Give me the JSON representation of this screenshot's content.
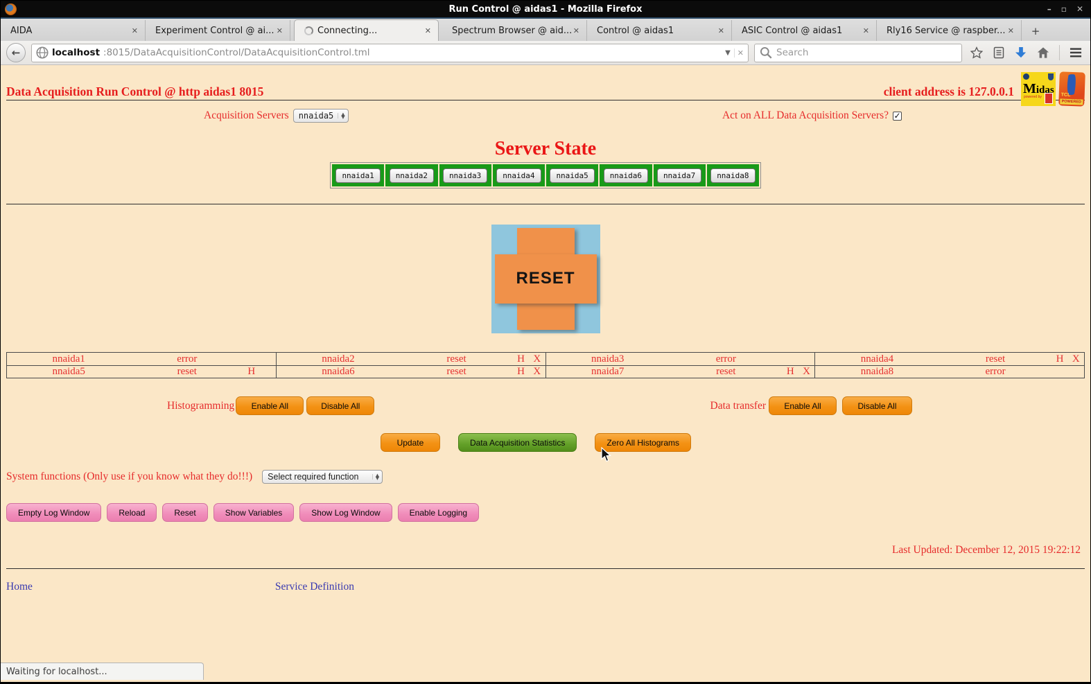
{
  "browser": {
    "window_title": "Run Control @ aidas1 - Mozilla Firefox",
    "tabs": [
      {
        "label": "AIDA"
      },
      {
        "label": "Experiment Control @ ai..."
      },
      {
        "label": "Connecting...",
        "active": true,
        "loading": true
      },
      {
        "label": "Spectrum Browser @ aid..."
      },
      {
        "label": "Control @ aidas1"
      },
      {
        "label": "ASIC Control @ aidas1"
      },
      {
        "label": "Rly16 Service @ raspber..."
      }
    ],
    "new_tab": "+",
    "url_host": "localhost",
    "url_path": ":8015/DataAcquisitionControl/DataAcquisitionControl.tml",
    "search_placeholder": "Search",
    "status_text": "Waiting for localhost..."
  },
  "page": {
    "title": "Data Acquisition Run Control @ http aidas1 8015",
    "client_address": "client address is 127.0.0.1",
    "acquisition_servers_label": "Acquisition Servers",
    "acquisition_servers_selected": "nnaida5",
    "act_on_all_label": "Act on ALL Data Acquisition Servers?",
    "act_on_all_checked": true,
    "server_state_heading": "Server State",
    "server_buttons": [
      "nnaida1",
      "nnaida2",
      "nnaida3",
      "nnaida4",
      "nnaida5",
      "nnaida6",
      "nnaida7",
      "nnaida8"
    ],
    "reset_label": "RESET",
    "status": {
      "rows": [
        [
          {
            "name": "nnaida1",
            "state": "error",
            "h": "",
            "x": ""
          },
          {
            "name": "nnaida2",
            "state": "reset",
            "h": "H",
            "x": "X"
          },
          {
            "name": "nnaida3",
            "state": "error",
            "h": "",
            "x": ""
          },
          {
            "name": "nnaida4",
            "state": "reset",
            "h": "H",
            "x": "X"
          }
        ],
        [
          {
            "name": "nnaida5",
            "state": "reset",
            "h": "H",
            "x": ""
          },
          {
            "name": "nnaida6",
            "state": "reset",
            "h": "H",
            "x": "X"
          },
          {
            "name": "nnaida7",
            "state": "reset",
            "h": "H",
            "x": "X"
          },
          {
            "name": "nnaida8",
            "state": "error",
            "h": "",
            "x": ""
          }
        ]
      ]
    },
    "histogramming": {
      "label": "Histogramming",
      "enable": "Enable All",
      "disable": "Disable All"
    },
    "data_transfer": {
      "label": "Data transfer",
      "enable": "Enable All",
      "disable": "Disable All"
    },
    "actions": {
      "update": "Update",
      "daq_stats": "Data Acquisition Statistics",
      "zero": "Zero All Histograms"
    },
    "system_functions": {
      "label": "System functions (Only use if you know what they do!!!)",
      "selected": "Select required function"
    },
    "log_buttons": [
      "Empty Log Window",
      "Reload",
      "Reset",
      "Show Variables",
      "Show Log Window",
      "Enable Logging"
    ],
    "last_updated": "Last Updated: December 12, 2015 19:22:12",
    "footer_links": {
      "home": "Home",
      "service_definition": "Service Definition"
    },
    "logos": {
      "midas_m": "M",
      "midas_rest": "idas",
      "midas_sub": "powered by",
      "tcl_text": "TCL",
      "tcl_sub": "POWERED"
    }
  },
  "colors": {
    "page_background": "#fbe7c7",
    "heading_red": "#e61e1e",
    "server_cell_green": "#189a18",
    "button_orange": "#f39214",
    "button_green": "#63a028",
    "button_pink": "#f08cba",
    "reset_background_blue": "#8fc6dd",
    "reset_cross_orange": "#f0914a",
    "link_blue": "#3a3ab0"
  }
}
